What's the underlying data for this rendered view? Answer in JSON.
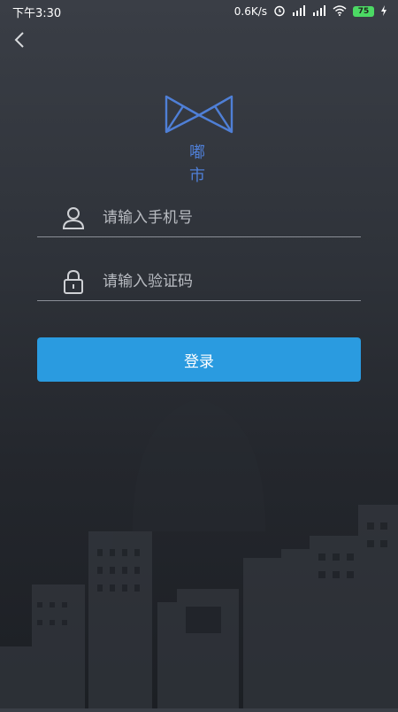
{
  "status_bar": {
    "time": "下午3:30",
    "network_speed": "0.6K/s",
    "battery_level": "75"
  },
  "brand": {
    "name": "嘟 市"
  },
  "form": {
    "phone_placeholder": "请输入手机号",
    "code_placeholder": "请输入验证码",
    "login_label": "登录"
  },
  "colors": {
    "accent": "#2a9be0",
    "brand": "#4f7fd6",
    "background": "#2f333a"
  }
}
